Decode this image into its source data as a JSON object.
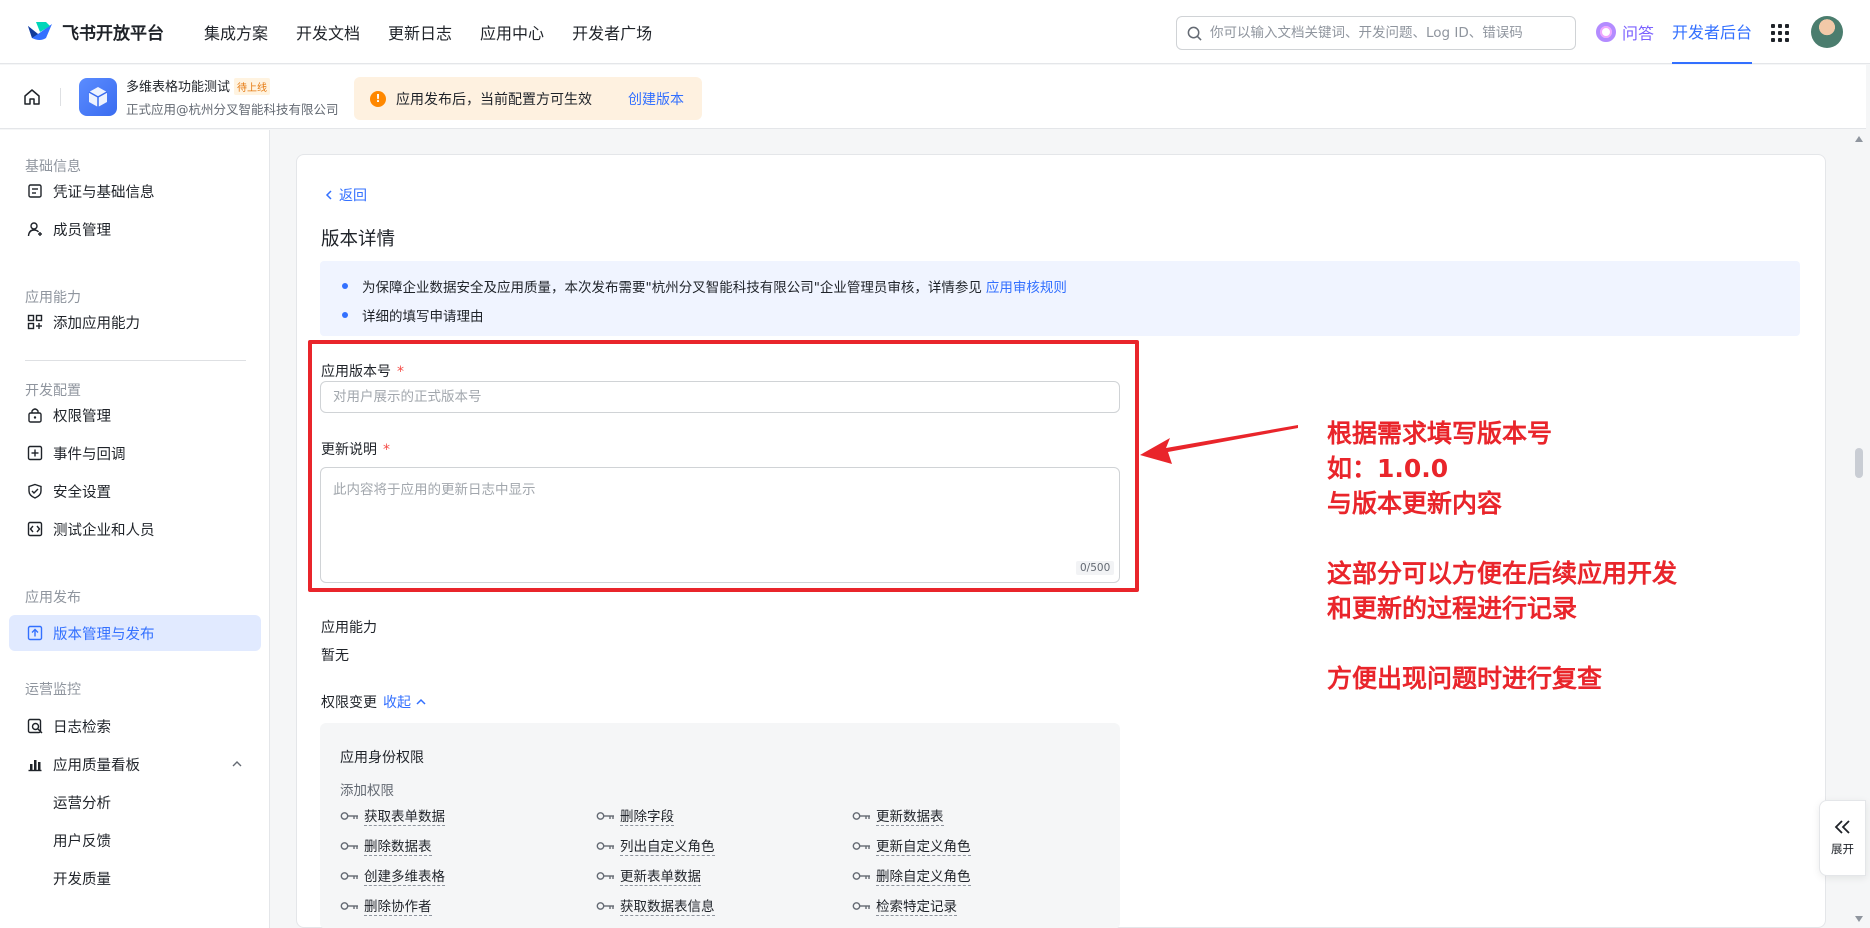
{
  "topbar": {
    "brand": "飞书开放平台",
    "nav": [
      "集成方案",
      "开发文档",
      "更新日志",
      "应用中心",
      "开发者广场"
    ],
    "search_placeholder": "你可以输入文档关键词、开发问题、Log ID、错误码",
    "qa": "问答",
    "console": "开发者后台"
  },
  "subbar": {
    "app_name": "多维表格功能测试",
    "app_badge": "待上线",
    "app_sub": "正式应用@杭州分叉智能科技有限公司",
    "notice": "应用发布后，当前配置方可生效",
    "notice_action": "创建版本"
  },
  "sidebar": {
    "sections": [
      "基础信息",
      "应用能力",
      "开发配置",
      "应用发布",
      "运营监控"
    ],
    "items": [
      {
        "label": "凭证与基础信息",
        "icon": "credential-icon"
      },
      {
        "label": "成员管理",
        "icon": "member-icon"
      },
      {
        "label": "添加应用能力",
        "icon": "ability-icon"
      },
      {
        "label": "权限管理",
        "icon": "permission-icon"
      },
      {
        "label": "事件与回调",
        "icon": "event-icon"
      },
      {
        "label": "安全设置",
        "icon": "shield-icon"
      },
      {
        "label": "测试企业和人员",
        "icon": "test-icon"
      },
      {
        "label": "版本管理与发布",
        "icon": "upload-icon"
      },
      {
        "label": "日志检索",
        "icon": "log-search-icon"
      },
      {
        "label": "应用质量看板",
        "icon": "chart-icon"
      },
      {
        "label": "运营分析",
        "icon": ""
      },
      {
        "label": "用户反馈",
        "icon": ""
      },
      {
        "label": "开发质量",
        "icon": ""
      }
    ]
  },
  "main": {
    "back": "返回",
    "title": "版本详情",
    "tips": [
      {
        "text": "为保障企业数据安全及应用质量，本次发布需要\"杭州分叉智能科技有限公司\"企业管理员审核，详情参见",
        "link": "应用审核规则"
      },
      {
        "text": "详细的填写申请理由",
        "link": ""
      }
    ],
    "version_label": "应用版本号",
    "version_placeholder": "对用户展示的正式版本号",
    "notes_label": "更新说明",
    "notes_placeholder": "此内容将于应用的更新日志中显示",
    "counter": "0/500",
    "ability_label": "应用能力",
    "ability_value": "暂无",
    "perm_change_label": "权限变更",
    "perm_collapse": "收起",
    "perm_box_title": "应用身份权限",
    "perm_box_sub": "添加权限",
    "permissions": [
      [
        "获取表单数据",
        "删除字段",
        "更新数据表"
      ],
      [
        "删除数据表",
        "列出自定义角色",
        "更新自定义角色"
      ],
      [
        "创建多维表格",
        "更新表单数据",
        "删除自定义角色"
      ],
      [
        "删除协作者",
        "获取数据表信息",
        "检索特定记录"
      ]
    ]
  },
  "annotation": {
    "lines": [
      "根据需求填写版本号",
      "如：1.0.0",
      "与版本更新内容",
      "",
      "这部分可以方便在后续应用开发",
      "和更新的过程进行记录",
      "",
      "方便出现问题时进行复查"
    ],
    "color": "#e9252b"
  },
  "expand": {
    "label": "展开"
  },
  "colors": {
    "primary": "#3370ff",
    "danger": "#f54a45",
    "warning": "#ff8800"
  }
}
